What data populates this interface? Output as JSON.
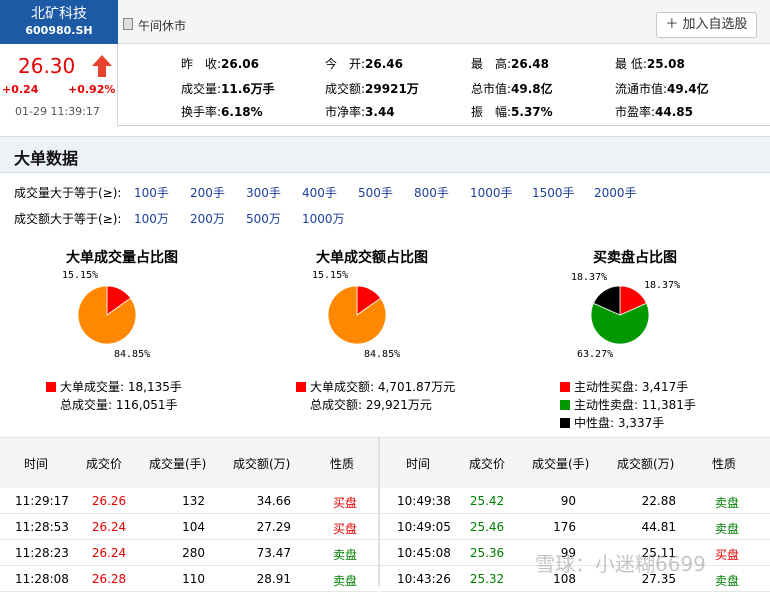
{
  "stock": {
    "name": "北矿科技",
    "code": "600980.SH",
    "price": "26.30",
    "change": "+0.24",
    "change_pct": "+0.92%",
    "time": "01-29 11:39:17"
  },
  "status": {
    "text": "午间休市",
    "add_button": "＋ 加入自选股"
  },
  "quote": [
    [
      {
        "k": "昨　收:",
        "v": "26.06"
      },
      {
        "k": "今　开:",
        "v": "26.46"
      },
      {
        "k": "最　高:",
        "v": "26.48"
      },
      {
        "k": "最 低:",
        "v": "25.08"
      }
    ],
    [
      {
        "k": "成交量:",
        "v": "11.6万手"
      },
      {
        "k": "成交额:",
        "v": "29921万"
      },
      {
        "k": "总市值:",
        "v": "49.8亿"
      },
      {
        "k": "流通市值:",
        "v": "49.4亿"
      }
    ],
    [
      {
        "k": "换手率:",
        "v": "6.18%"
      },
      {
        "k": "市净率:",
        "v": "3.44"
      },
      {
        "k": "振　幅:",
        "v": "5.37%"
      },
      {
        "k": "市盈率:",
        "v": "44.85"
      }
    ]
  ],
  "section_title": "大单数据",
  "filters": {
    "vol_label": "成交量大于等于(≥):",
    "vol_links": [
      "100手",
      "200手",
      "300手",
      "400手",
      "500手",
      "800手",
      "1000手",
      "1500手",
      "2000手"
    ],
    "amt_label": "成交额大于等于(≥):",
    "amt_links": [
      "100万",
      "200万",
      "500万",
      "1000万"
    ]
  },
  "chart_data": [
    {
      "type": "pie",
      "title": "大单成交量占比图",
      "slices": [
        {
          "label": "15.15%",
          "value": 15.15,
          "color": "#ff0000"
        },
        {
          "label": "84.85%",
          "value": 84.85,
          "color": "#ff8800"
        }
      ],
      "legend": [
        {
          "text": "大单成交量: 18,135手",
          "color": "#ff0000"
        },
        {
          "text": "总成交量: 116,051手",
          "color": ""
        }
      ]
    },
    {
      "type": "pie",
      "title": "大单成交额占比图",
      "slices": [
        {
          "label": "15.15%",
          "value": 15.15,
          "color": "#ff0000"
        },
        {
          "label": "84.85%",
          "value": 84.85,
          "color": "#ff8800"
        }
      ],
      "legend": [
        {
          "text": "大单成交额: 4,701.87万元",
          "color": "#ff0000"
        },
        {
          "text": "总成交额: 29,921万元",
          "color": ""
        }
      ]
    },
    {
      "type": "pie",
      "title": "买卖盘占比图",
      "slices": [
        {
          "label": "18.37%",
          "value": 18.37,
          "color": "#ff0000"
        },
        {
          "label": "63.27%",
          "value": 63.27,
          "color": "#009900"
        },
        {
          "label": "18.37%",
          "value": 18.37,
          "color": "#000000"
        }
      ],
      "legend": [
        {
          "text": "主动性买盘: 3,417手",
          "color": "#ff0000"
        },
        {
          "text": "主动性卖盘: 11,381手",
          "color": "#009900"
        },
        {
          "text": "中性盘: 3,337手",
          "color": "#000000"
        }
      ]
    }
  ],
  "table": {
    "headers": [
      "时间",
      "成交价",
      "成交量(手)",
      "成交额(万)",
      "性质"
    ],
    "left": [
      {
        "time": "11:29:17",
        "price": "26.26",
        "vol": "132",
        "amt": "34.66",
        "type": "买盘",
        "dir": "buy"
      },
      {
        "time": "11:28:53",
        "price": "26.24",
        "vol": "104",
        "amt": "27.29",
        "type": "买盘",
        "dir": "buy"
      },
      {
        "time": "11:28:23",
        "price": "26.24",
        "vol": "280",
        "amt": "73.47",
        "type": "卖盘",
        "dir": "sell"
      },
      {
        "time": "11:28:08",
        "price": "26.28",
        "vol": "110",
        "amt": "28.91",
        "type": "卖盘",
        "dir": "sell"
      }
    ],
    "right": [
      {
        "time": "10:49:38",
        "price": "25.42",
        "vol": "90",
        "amt": "22.88",
        "type": "卖盘",
        "dir": "sell"
      },
      {
        "time": "10:49:05",
        "price": "25.46",
        "vol": "176",
        "amt": "44.81",
        "type": "卖盘",
        "dir": "sell"
      },
      {
        "time": "10:45:08",
        "price": "25.36",
        "vol": "99",
        "amt": "25.11",
        "type": "买盘",
        "dir": "buy"
      },
      {
        "time": "10:43:26",
        "price": "25.32",
        "vol": "108",
        "amt": "27.35",
        "type": "卖盘",
        "dir": "sell"
      }
    ]
  },
  "watermark": "雪球：小迷糊6699",
  "colors": {
    "up": "#e60000",
    "down": "#008000",
    "brand": "#1d5aa6",
    "link": "#1d3f9c"
  }
}
